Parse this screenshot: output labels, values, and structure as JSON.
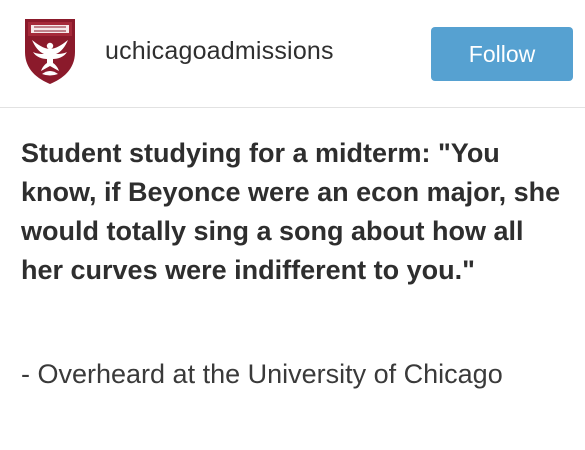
{
  "header": {
    "username": "uchicagoadmissions",
    "follow_label": "Follow",
    "avatar_icon": "university-of-chicago-shield-icon",
    "follow_color": "#56a1d1",
    "shield_color": "#8b1a2b"
  },
  "post": {
    "text": "Student studying for a midterm: \"You know, if Beyonce were an econ major, she would totally sing a song about how all her curves were indifferent to you.\"",
    "attribution": "- Overheard at the University of Chicago"
  }
}
